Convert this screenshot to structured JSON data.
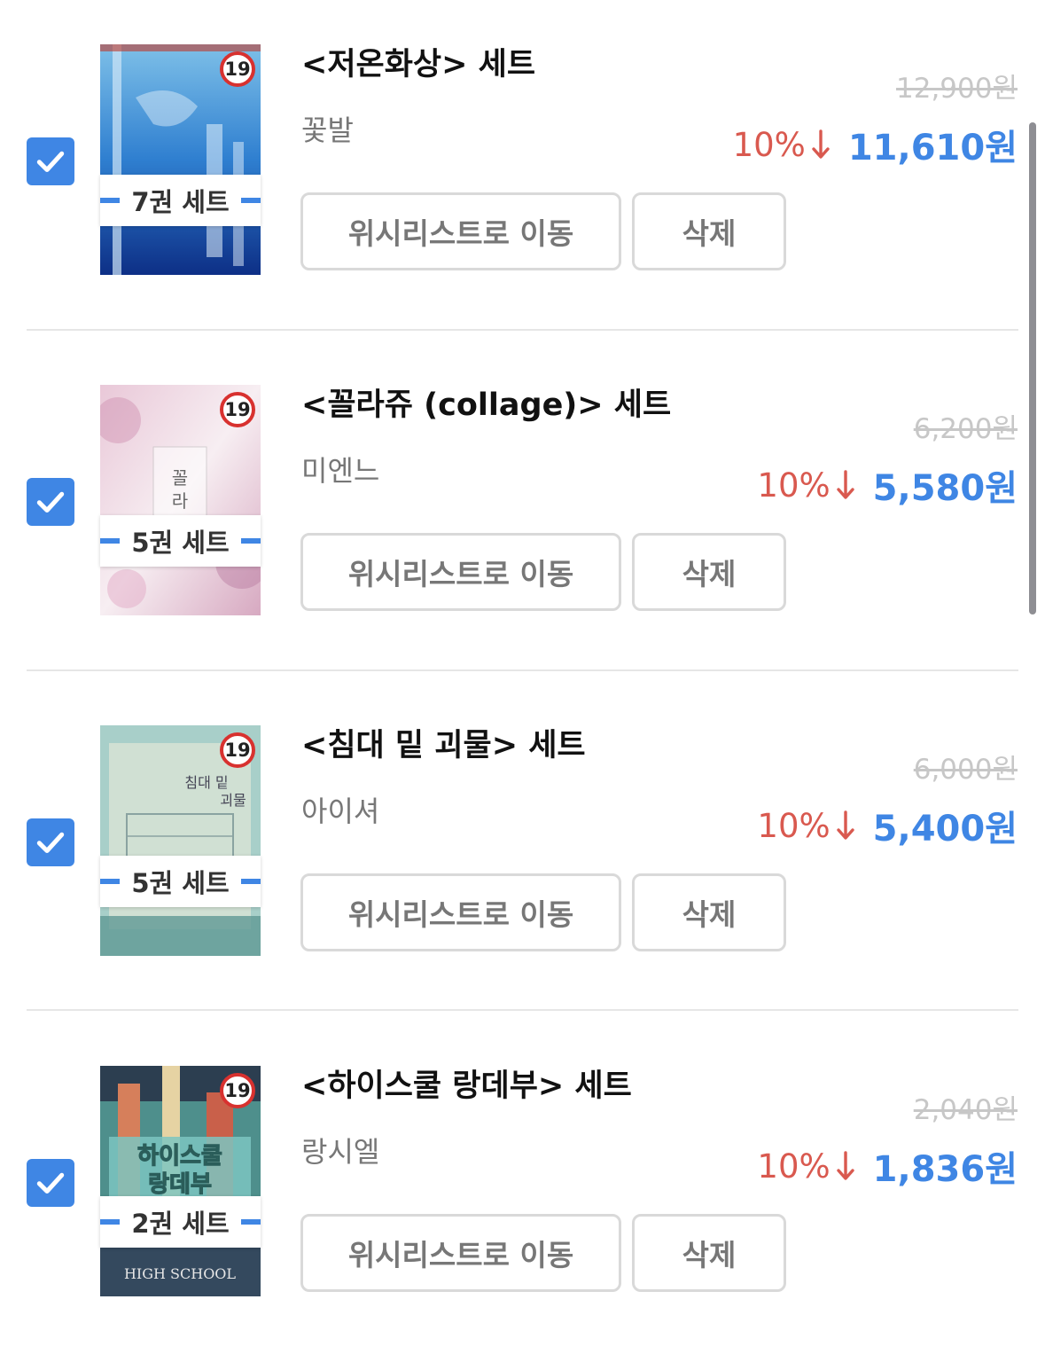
{
  "colors": {
    "accent": "#3f86e4",
    "discount": "#d9594f",
    "strike": "#c7c7c7",
    "age_badge_ring": "#d8312f"
  },
  "items": [
    {
      "checked": true,
      "cover_icon": "book-cover-blue",
      "age_badge": "19",
      "set_label": "7권 세트",
      "title": "<저온화상> 세트",
      "author": "꽃발",
      "original_price": "12,900원",
      "discount": "10%",
      "sale_price": "11,610원",
      "wishlist_button": "위시리스트로 이동",
      "delete_button": "삭제"
    },
    {
      "checked": true,
      "cover_icon": "book-cover-pink",
      "age_badge": "19",
      "set_label": "5권 세트",
      "title": "<꼴라쥬 (collage)> 세트",
      "author": "미엔느",
      "original_price": "6,200원",
      "discount": "10%",
      "sale_price": "5,580원",
      "wishlist_button": "위시리스트로 이동",
      "delete_button": "삭제"
    },
    {
      "checked": true,
      "cover_icon": "book-cover-teal",
      "age_badge": "19",
      "set_label": "5권 세트",
      "title": "<침대 밑 괴물> 세트",
      "author": "아이셔",
      "original_price": "6,000원",
      "discount": "10%",
      "sale_price": "5,400원",
      "wishlist_button": "위시리스트로 이동",
      "delete_button": "삭제"
    },
    {
      "checked": true,
      "cover_icon": "book-cover-retro",
      "age_badge": "19",
      "set_label": "2권 세트",
      "title": "<하이스쿨 랑데부> 세트",
      "author": "랑시엘",
      "original_price": "2,040원",
      "discount": "10%",
      "sale_price": "1,836원",
      "wishlist_button": "위시리스트로 이동",
      "delete_button": "삭제"
    }
  ]
}
